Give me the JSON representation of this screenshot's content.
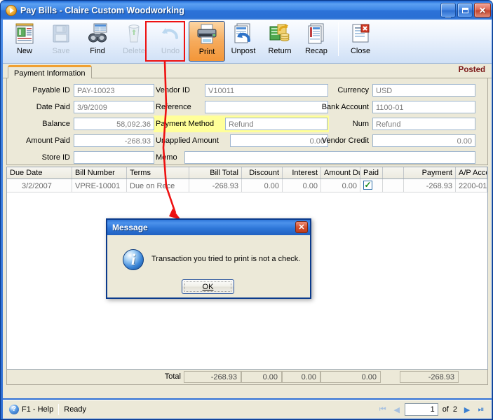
{
  "window": {
    "title": "Pay Bills - Claire Custom Woodworking",
    "app_icon": "play-circle-icon",
    "buttons": {
      "minimize": "_",
      "maximize": "□",
      "close": "✕"
    }
  },
  "toolbar": {
    "items": [
      {
        "label": "New",
        "icon": "new-document-icon",
        "enabled": true,
        "active": false
      },
      {
        "label": "Save",
        "icon": "floppy-disk-icon",
        "enabled": false,
        "active": false
      },
      {
        "label": "Find",
        "icon": "binoculars-icon",
        "enabled": true,
        "active": false
      },
      {
        "label": "Delete",
        "icon": "recycle-bin-icon",
        "enabled": false,
        "active": false
      },
      {
        "label": "Undo",
        "icon": "undo-arrow-icon",
        "enabled": false,
        "active": false
      },
      {
        "label": "Print",
        "icon": "printer-icon",
        "enabled": true,
        "active": true
      },
      {
        "label": "Unpost",
        "icon": "unpost-icon",
        "enabled": true,
        "active": false
      },
      {
        "label": "Return",
        "icon": "return-money-icon",
        "enabled": true,
        "active": false
      },
      {
        "label": "Recap",
        "icon": "recap-report-icon",
        "enabled": true,
        "active": false
      },
      {
        "label": "Close",
        "icon": "close-document-icon",
        "enabled": true,
        "active": false
      }
    ]
  },
  "annotation": {
    "highlight_target": "Print",
    "highlight_color": "#ee1111",
    "arrow_color": "#ee1111"
  },
  "tab": {
    "label": "Payment Information",
    "status": "Posted",
    "status_color": "#7a1616"
  },
  "form": {
    "payable_id": {
      "label": "Payable ID",
      "value": "PAY-10023"
    },
    "date_paid": {
      "label": "Date Paid",
      "value": "3/9/2009"
    },
    "balance": {
      "label": "Balance",
      "value": "58,092.36"
    },
    "amount_paid": {
      "label": "Amount Paid",
      "value": "-268.93"
    },
    "store_id": {
      "label": "Store ID",
      "value": ""
    },
    "vendor_id": {
      "label": "Vendor ID",
      "value": "V10011"
    },
    "reference": {
      "label": "Reference",
      "value": ""
    },
    "payment_method": {
      "label": "Payment Method",
      "value": "Refund",
      "highlighted": true,
      "highlight_color": "#ffff99"
    },
    "unapplied_amount": {
      "label": "Unapplied Amount",
      "value": "0.00"
    },
    "memo": {
      "label": "Memo",
      "value": ""
    },
    "currency": {
      "label": "Currency",
      "value": "USD"
    },
    "bank_account": {
      "label": "Bank Account",
      "value": "1100-01"
    },
    "num": {
      "label": "Num",
      "value": "Refund"
    },
    "vendor_credit": {
      "label": "Vendor Credit",
      "value": "0.00"
    }
  },
  "grid": {
    "headers": [
      "Due Date",
      "Bill Number",
      "Terms",
      "Bill Total",
      "Discount",
      "Interest",
      "Amount Due",
      "Paid",
      "",
      "Payment",
      "A/P Account"
    ],
    "row": {
      "due_date": "3/2/2007",
      "bill_number": "VPRE-10001",
      "terms": "Due on Rece",
      "bill_total": "-268.93",
      "discount": "0.00",
      "interest": "0.00",
      "amount_due": "0.00",
      "paid": true,
      "blank": "",
      "payment": "-268.93",
      "ap_account": "2200-01"
    },
    "totals": {
      "label": "Total",
      "bill_total": "-268.93",
      "discount": "0.00",
      "interest": "0.00",
      "amount_due": "0.00",
      "payment": "-268.93"
    }
  },
  "dialog": {
    "title": "Message",
    "icon": "info-icon",
    "message": "Transaction you tried to print is not a check.",
    "ok_label": "OK",
    "close_glyph": "✕"
  },
  "statusbar": {
    "help_icon": "question-mark-icon",
    "help_text": "F1 - Help",
    "ready_text": "Ready",
    "nav": {
      "first": "⏮",
      "prev": "◀",
      "page": "1",
      "of": "of",
      "total": "2",
      "next": "▶",
      "last": "⏭"
    }
  }
}
